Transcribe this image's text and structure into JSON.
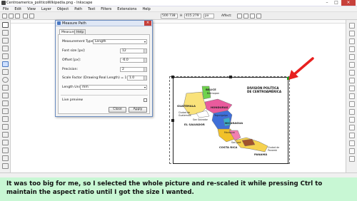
{
  "window": {
    "title": "Centroamerica_politicoWikipedia.png - Inkscape",
    "controls": [
      "–",
      "□",
      "×"
    ]
  },
  "menu": {
    "items": [
      "File",
      "Edit",
      "View",
      "Layer",
      "Object",
      "Path",
      "Text",
      "Filters",
      "Extensions",
      "Help"
    ]
  },
  "toolbar": {
    "x_value": "500.738",
    "h_label": "H",
    "h_value": "415.279",
    "unit": "px",
    "affect_label": "Affect:"
  },
  "dialog": {
    "title": "Measure Path",
    "tabs": [
      "Measure",
      "Help"
    ],
    "fields": {
      "measurement_type_label": "Measurement Type:",
      "measurement_type_value": "Length",
      "font_size_label": "Font size [px]:",
      "font_size_value": "12",
      "offset_label": "Offset [px]:",
      "offset_value": "-6.0",
      "precision_label": "Precision:",
      "precision_value": "2",
      "scale_label": "Scale Factor (Drawing:Real Length) = 1:",
      "scale_value": "1.0",
      "length_unit_label": "Length Unit:",
      "length_unit_value": "mm"
    },
    "live_preview_label": "Live preview",
    "close_label": "Close",
    "apply_label": "Apply"
  },
  "map": {
    "title_line1": "DIVISIÓN POLÍTICA",
    "title_line2": "DE CENTROAMÉRICA",
    "labels": {
      "belize": "BELICE",
      "belmopan": "Belmopan",
      "guatemala": "GUATEMALA",
      "ciudad_guatemala": "Ciudad de Guatemala",
      "honduras": "HONDURAS",
      "tegucigalpa": "Tegucigalpa",
      "san_salvador": "San Salvador",
      "el_salvador": "EL SALVADOR",
      "nicaragua": "NICARAGUA",
      "managua": "Managua",
      "san_jose": "San José",
      "costa_rica": "COSTA RICA",
      "panama": "PANAMÁ",
      "ciudad_panama": "Ciudad de Panamá"
    }
  },
  "caption": {
    "text": "It was too big for me, so I selected the whole picture and re-scaled it while pressing Ctrl to maintain the aspect ratio until I got the size I wanted."
  },
  "colors": {
    "accent_arrow": "#e8201f",
    "caption_bg": "#c8f7d4"
  }
}
